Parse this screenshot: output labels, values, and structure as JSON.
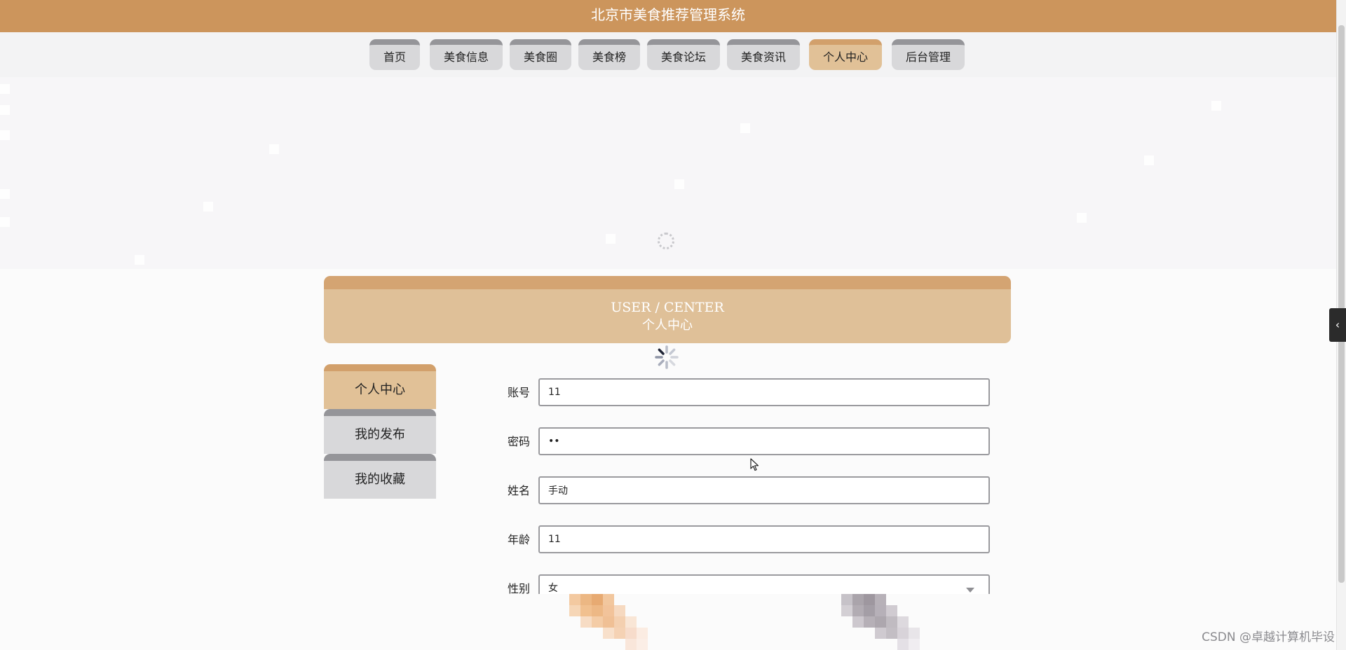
{
  "header": {
    "title": "北京市美食推荐管理系统"
  },
  "nav": {
    "items": [
      {
        "label": "首页",
        "active": false
      },
      {
        "label": "美食信息",
        "active": false
      },
      {
        "label": "美食圈",
        "active": false
      },
      {
        "label": "美食榜",
        "active": false
      },
      {
        "label": "美食论坛",
        "active": false
      },
      {
        "label": "美食资讯",
        "active": false
      },
      {
        "label": "个人中心",
        "active": true
      },
      {
        "label": "后台管理",
        "active": false
      }
    ]
  },
  "banner": {
    "loading_icon": "spinner-icon"
  },
  "section": {
    "title_en": "USER / CENTER",
    "title_cn": "个人中心"
  },
  "side_menu": {
    "items": [
      {
        "label": "个人中心",
        "active": true
      },
      {
        "label": "我的发布",
        "active": false
      },
      {
        "label": "我的收藏",
        "active": false
      }
    ]
  },
  "form": {
    "fields": [
      {
        "label": "账号",
        "value": "11",
        "type": "text"
      },
      {
        "label": "密码",
        "value": "11",
        "type": "password"
      },
      {
        "label": "姓名",
        "value": "手动",
        "type": "text"
      },
      {
        "label": "年龄",
        "value": "11",
        "type": "text"
      },
      {
        "label": "性别",
        "value": "女",
        "type": "select"
      }
    ]
  },
  "side_tab": {
    "icon": "chevron-left-icon",
    "glyph": "‹"
  },
  "watermark": {
    "text": "CSDN @卓越计算机毕设"
  },
  "colors": {
    "brand": "#cc955c",
    "active_tab": "#e1c197",
    "inactive_tab": "#d8d8da"
  }
}
